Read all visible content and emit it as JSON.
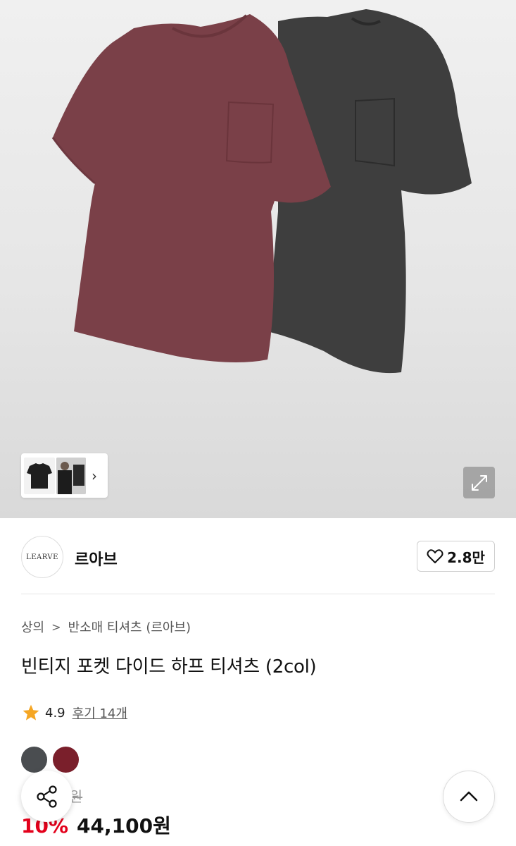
{
  "gallery": {
    "expand_icon": "expand-icon",
    "next_icon": "chevron-right-icon",
    "thumb_next": "›"
  },
  "brand": {
    "logo_text": "LEARVE",
    "name": "르아브",
    "like_icon": "heart-icon",
    "like_count": "2.8만"
  },
  "product": {
    "breadcrumb": [
      "상의",
      "반소매 티셔츠 (르아브)"
    ],
    "title": "빈티지 포켓 다이드 하프 티셔츠 (2col)",
    "rating": {
      "score": "4.9",
      "reviews_label": "후기 14개"
    },
    "colors": [
      "#4a4d50",
      "#7a1f2b"
    ],
    "original_price_visible": "0원",
    "discount": "10%",
    "price": "44,100원"
  },
  "floating": {
    "share_icon": "share-icon",
    "top_icon": "chevron-up-icon"
  }
}
